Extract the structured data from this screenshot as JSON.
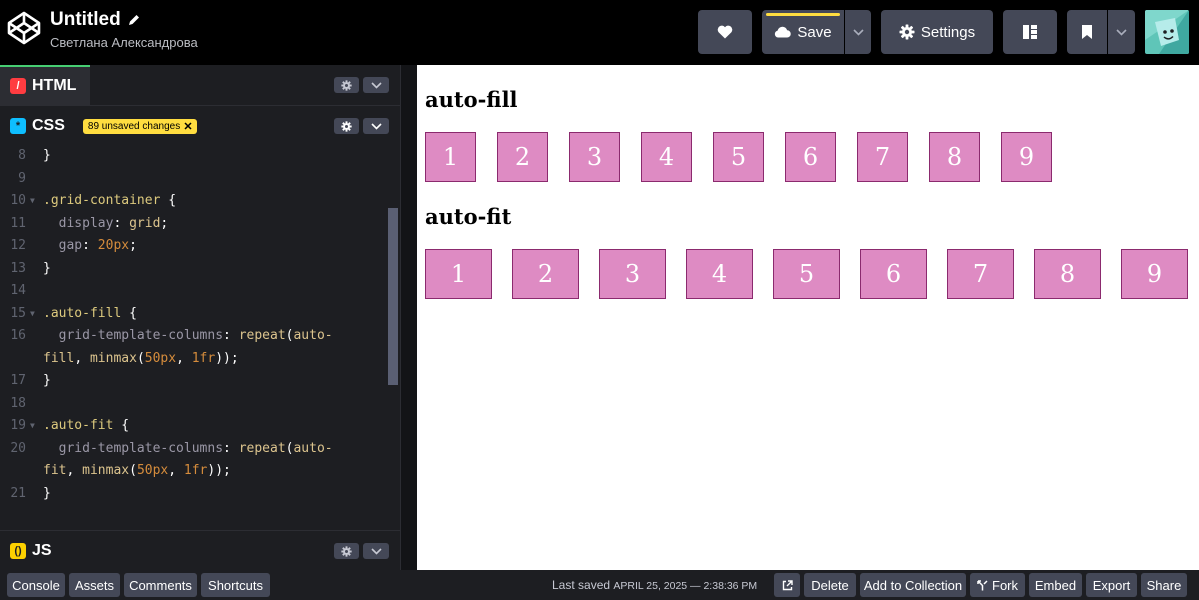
{
  "header": {
    "title": "Untitled",
    "author": "Светлана Александрова",
    "save_label": "Save",
    "settings_label": "Settings"
  },
  "panels": {
    "html": {
      "label": "HTML"
    },
    "css": {
      "label": "CSS",
      "unsaved_badge": "89 unsaved changes"
    },
    "js": {
      "label": "JS"
    }
  },
  "code_lines": [
    {
      "n": "8",
      "fold": false,
      "parts": [
        [
          "t",
          "}"
        ]
      ]
    },
    {
      "n": "9",
      "fold": false,
      "parts": []
    },
    {
      "n": "10",
      "fold": true,
      "parts": [
        [
          "sel",
          ".grid-container"
        ],
        [
          "t",
          " {"
        ]
      ]
    },
    {
      "n": "11",
      "fold": false,
      "parts": [
        [
          "t",
          "  "
        ],
        [
          "prop",
          "display"
        ],
        [
          "t",
          ": "
        ],
        [
          "val",
          "grid"
        ],
        [
          "t",
          ";"
        ]
      ]
    },
    {
      "n": "12",
      "fold": false,
      "parts": [
        [
          "t",
          "  "
        ],
        [
          "prop",
          "gap"
        ],
        [
          "t",
          ": "
        ],
        [
          "num",
          "20px"
        ],
        [
          "t",
          ";"
        ]
      ]
    },
    {
      "n": "13",
      "fold": false,
      "parts": [
        [
          "t",
          "}"
        ]
      ]
    },
    {
      "n": "14",
      "fold": false,
      "parts": []
    },
    {
      "n": "15",
      "fold": true,
      "parts": [
        [
          "sel",
          ".auto-fill"
        ],
        [
          "t",
          " {"
        ]
      ]
    },
    {
      "n": "16",
      "fold": false,
      "parts": [
        [
          "t",
          "  "
        ],
        [
          "prop",
          "grid-template-columns"
        ],
        [
          "t",
          ": "
        ],
        [
          "fn",
          "repeat"
        ],
        [
          "t",
          "("
        ],
        [
          "val",
          "auto-"
        ]
      ]
    },
    {
      "n": "",
      "fold": false,
      "parts": [
        [
          "val",
          "fill"
        ],
        [
          "t",
          ", "
        ],
        [
          "fn",
          "minmax"
        ],
        [
          "t",
          "("
        ],
        [
          "num",
          "50px"
        ],
        [
          "t",
          ", "
        ],
        [
          "num",
          "1fr"
        ],
        [
          "t",
          "));"
        ]
      ]
    },
    {
      "n": "17",
      "fold": false,
      "parts": [
        [
          "t",
          "}"
        ]
      ]
    },
    {
      "n": "18",
      "fold": false,
      "parts": []
    },
    {
      "n": "19",
      "fold": true,
      "parts": [
        [
          "sel",
          ".auto-fit"
        ],
        [
          "t",
          " {"
        ]
      ]
    },
    {
      "n": "20",
      "fold": false,
      "parts": [
        [
          "t",
          "  "
        ],
        [
          "prop",
          "grid-template-columns"
        ],
        [
          "t",
          ": "
        ],
        [
          "fn",
          "repeat"
        ],
        [
          "t",
          "("
        ],
        [
          "val",
          "auto-"
        ]
      ]
    },
    {
      "n": "",
      "fold": false,
      "parts": [
        [
          "val",
          "fit"
        ],
        [
          "t",
          ", "
        ],
        [
          "fn",
          "minmax"
        ],
        [
          "t",
          "("
        ],
        [
          "num",
          "50px"
        ],
        [
          "t",
          ", "
        ],
        [
          "num",
          "1fr"
        ],
        [
          "t",
          "));"
        ]
      ]
    },
    {
      "n": "21",
      "fold": false,
      "parts": [
        [
          "t",
          "}"
        ]
      ]
    }
  ],
  "preview": {
    "auto_fill_heading": "auto-fill",
    "auto_fit_heading": "auto-fit",
    "auto_fill_items": [
      "1",
      "2",
      "3",
      "4",
      "5",
      "6",
      "7",
      "8",
      "9"
    ],
    "auto_fit_items": [
      "1",
      "2",
      "3",
      "4",
      "5",
      "6",
      "7",
      "8",
      "9"
    ]
  },
  "footer": {
    "buttons_left": [
      "Console",
      "Assets",
      "Comments",
      "Shortcuts"
    ],
    "last_saved_label": "Last saved",
    "last_saved_time": "APRIL 25, 2025 — 2:38:36 PM",
    "delete_label": "Delete",
    "add_collection_label": "Add to Collection",
    "fork_label": "Fork",
    "embed_label": "Embed",
    "export_label": "Export",
    "share_label": "Share"
  },
  "colors": {
    "accent_yellow": "#ffdd40",
    "cell_bg": "#de8bc3",
    "cell_border": "#8b2a6e"
  }
}
